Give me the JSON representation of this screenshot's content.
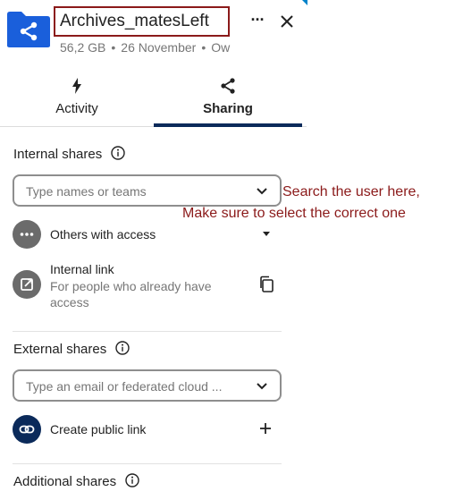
{
  "header": {
    "title": "Archives_matesLeft",
    "size": "56,2 GB",
    "date": "26 November",
    "owner_truncated": "Ow",
    "more_label": "···"
  },
  "tabs": [
    {
      "label": "Activity",
      "icon": "lightning-icon"
    },
    {
      "label": "Sharing",
      "icon": "share-icon",
      "active": true
    }
  ],
  "internal": {
    "title": "Internal shares",
    "placeholder": "Type names or teams",
    "others_label": "Others with access",
    "link_label": "Internal link",
    "link_sub": "For people who already have access"
  },
  "external": {
    "title": "External shares",
    "placeholder": "Type an email or federated cloud ...",
    "public_link_label": "Create public link"
  },
  "additional": {
    "title": "Additional shares"
  },
  "annotation": {
    "line1": "Search the user here,",
    "line2": "Make sure to select the correct one"
  },
  "colors": {
    "brand": "#0082c9",
    "folder": "#1a5fdb",
    "annotation": "#8b1a1a",
    "active_tab": "#0b2a5a"
  }
}
